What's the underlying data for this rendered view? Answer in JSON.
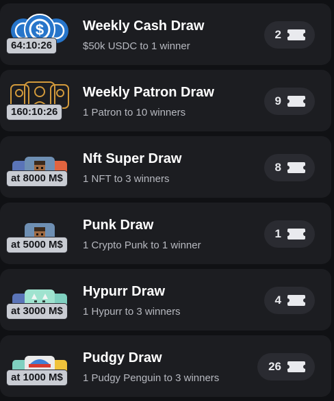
{
  "draws": [
    {
      "title": "Weekly Cash Draw",
      "subtitle": "$50k USDC to 1 winner",
      "badge": "64:10:26",
      "tickets": "2",
      "art": "usdc-coin-icon"
    },
    {
      "title": "Weekly Patron Draw",
      "subtitle": "1 Patron to 10 winners",
      "badge": "160:10:26",
      "tickets": "9",
      "art": "patron-art-icon"
    },
    {
      "title": "Nft Super Draw",
      "subtitle": "1 NFT to 3 winners",
      "badge": "at 8000 M$",
      "tickets": "8",
      "art": "nft-stack-icon"
    },
    {
      "title": "Punk Draw",
      "subtitle": "1 Crypto Punk to 1 winner",
      "badge": "at 5000 M$",
      "tickets": "1",
      "art": "crypto-punk-icon"
    },
    {
      "title": "Hypurr Draw",
      "subtitle": "1 Hypurr to 3 winners",
      "badge": "at 3000 M$",
      "tickets": "4",
      "art": "hypurr-cat-icon"
    },
    {
      "title": "Pudgy Draw",
      "subtitle": "1 Pudgy Penguin to 3 winners",
      "badge": "at 1000 M$",
      "tickets": "26",
      "art": "pudgy-penguin-icon"
    }
  ],
  "colors": {
    "background": "#101114",
    "card": "#1c1d21",
    "ticket_pill": "#2a2b31",
    "badge": "#c9ccd3",
    "usdc_blue": "#2775ca",
    "patron_gold": "#d39a3b"
  }
}
